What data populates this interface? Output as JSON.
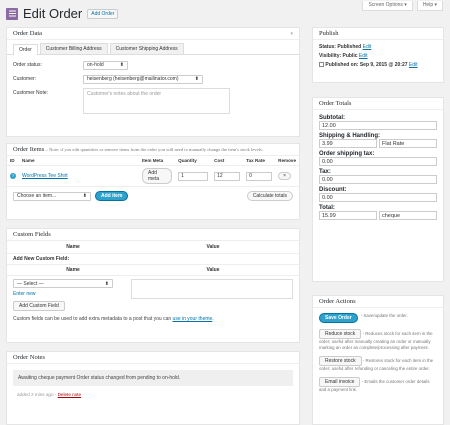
{
  "header": {
    "title": "Edit Order",
    "add_label": "Add Order",
    "screen_options": "Screen Options ▾",
    "help": "Help ▾"
  },
  "order_data": {
    "title": "Order Data",
    "tabs": [
      "Order",
      "Customer Billing Address",
      "Customer Shipping Address"
    ],
    "status_label": "Order status:",
    "status_value": "on-hold",
    "customer_label": "Customer:",
    "customer_value": "heisenberg (heisenberg@mailinator.com)",
    "note_label": "Customer Note:",
    "note_placeholder": "Customer's notes about the order"
  },
  "order_items": {
    "title": "Order Items",
    "note": "– Note: if you edit quantities or remove items from the order you will need to manually change the item's stock levels.",
    "columns": [
      "ID",
      "Name",
      "Item Meta",
      "Quantity",
      "Cost",
      "Tax Rate",
      "Remove"
    ],
    "item": {
      "name": "WordPress Tee Shirt",
      "meta_btn": "Add meta",
      "quantity": "1",
      "cost": "12",
      "tax": "0",
      "remove": "×"
    },
    "choose": "Choose an item...",
    "add_btn": "Add item",
    "calc_btn": "Calculate totals"
  },
  "custom_fields": {
    "title": "Custom Fields",
    "col_name": "Name",
    "col_value": "Value",
    "add_new": "Add New Custom Field:",
    "select": "— Select —",
    "enter_new": "Enter new",
    "add_btn": "Add Custom Field",
    "footer_text": "Custom fields can be used to add extra metadata to a post that you can",
    "footer_link": "use in your theme",
    "footer_end": "."
  },
  "order_notes": {
    "title": "Order Notes",
    "note": "Awaiting cheque payment Order status changed from pending to on-hold.",
    "meta": "added 2 mins ago -",
    "delete": "Delete note"
  },
  "publish": {
    "title": "Publish",
    "status": "Status: Published",
    "visibility": "Visibility: Public",
    "published_on": "Published on: Sep 9, 2015 @ 20:27",
    "edit": "Edit"
  },
  "totals": {
    "title": "Order Totals",
    "subtotal_label": "Subtotal:",
    "subtotal": "12.00",
    "shipping_label": "Shipping & Handling:",
    "shipping": "3.99",
    "shipping_method": "Flat Rate",
    "ship_tax_label": "Order shipping tax:",
    "ship_tax": "0.00",
    "tax_label": "Tax:",
    "tax": "0.00",
    "discount_label": "Discount:",
    "discount": "0.00",
    "total_label": "Total:",
    "total": "15.99",
    "payment": "cheque"
  },
  "actions": {
    "title": "Order Actions",
    "save_btn": "Save Order",
    "save_desc": "- Save/update the order.",
    "reduce_btn": "Reduce stock",
    "reduce_desc": "- Reduces stock for each item in the order; useful after manually creating an order or manually marking an order as complete/processing after payment.",
    "restore_btn": "Restore stock",
    "restore_desc": "- Restores stock for each item in the order; useful after refunding or canceling the entire order.",
    "email_btn": "Email invoice",
    "email_desc": "- Emails the customer order details and a payment link."
  }
}
